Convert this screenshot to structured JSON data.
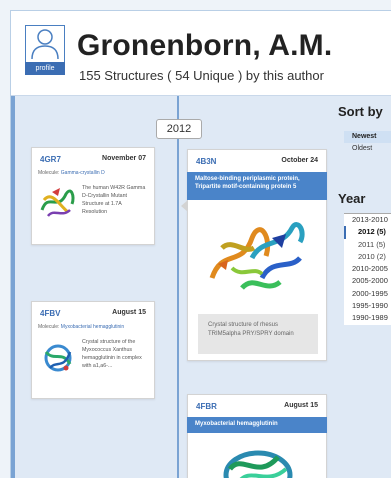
{
  "header": {
    "profile_label": "profile",
    "author_name": "Gronenborn, A.M.",
    "subtitle": "155 Structures ( 54 Unique ) by this author"
  },
  "timeline": {
    "year_label": "2012"
  },
  "cards": [
    {
      "id": "4GR7",
      "date": "November 07",
      "molecule_prefix": "Molecule: ",
      "molecule": "Gamma-crystallin D",
      "description": "The human W42R Gamma D-Crystallin Mutant Structure at 1.7A Resolution"
    },
    {
      "id": "4FBV",
      "date": "August 15",
      "molecule_prefix": "Molecule: ",
      "molecule": "Myxobacterial hemagglutinin",
      "description": "Crystal structure of the Myxococcus Xanthus hemagglutinin in complex with a1,a6-..."
    },
    {
      "id": "4B3N",
      "date": "October 24",
      "title": "Maltose-binding periplasmic protein, Tripartite motif-containing protein 5",
      "caption": "Crystal structure of rhesus TRIM5alpha PRY/SPRY domain"
    },
    {
      "id": "4FBR",
      "date": "August 15",
      "title": "Myxobacterial hemagglutinin"
    }
  ],
  "sidebar": {
    "sort_title": "Sort by",
    "sort_options": [
      "Newest",
      "Oldest"
    ],
    "year_title": "Year",
    "years": [
      "2013-2010",
      "2012 (5)",
      "2011 (5)",
      "2010 (2)",
      "2010-2005",
      "2005-2000",
      "2000-1995",
      "1995-1990",
      "1990-1989"
    ]
  }
}
